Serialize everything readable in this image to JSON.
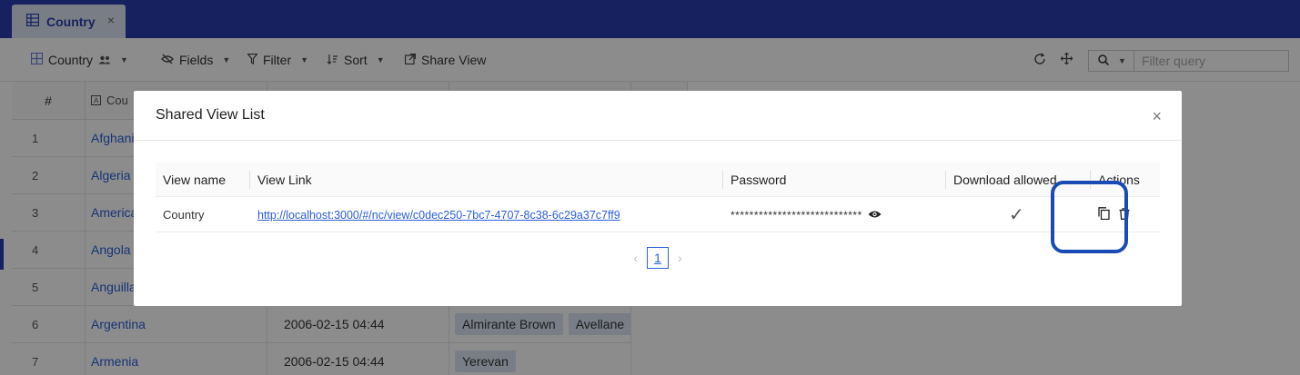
{
  "tab": {
    "label": "Country",
    "close": "×"
  },
  "toolbar": {
    "view_name": "Country",
    "fields": "Fields",
    "filter": "Filter",
    "sort": "Sort",
    "share_view": "Share View",
    "filter_placeholder": "Filter query"
  },
  "grid": {
    "headers": {
      "num": "#",
      "country": "Cou"
    },
    "rows": [
      {
        "num": "1",
        "country": "Afghani"
      },
      {
        "num": "2",
        "country": "Algeria"
      },
      {
        "num": "3",
        "country": "America"
      },
      {
        "num": "4",
        "country": "Angola"
      },
      {
        "num": "5",
        "country": "Anguilla"
      },
      {
        "num": "6",
        "country": "Argentina",
        "date": "2006-02-15 04:44",
        "cities": [
          "Almirante Brown",
          "Avellane"
        ]
      },
      {
        "num": "7",
        "country": "Armenia",
        "date": "2006-02-15 04:44",
        "cities": [
          "Yerevan"
        ]
      }
    ]
  },
  "modal": {
    "title": "Shared View List",
    "close": "×",
    "columns": [
      "View name",
      "View Link",
      "Password",
      "Download allowed",
      "Actions"
    ],
    "row": {
      "view_name": "Country",
      "link": "http://localhost:3000/#/nc/view/c0dec250-7bc7-4707-8c38-6c29a37c7ff9",
      "password": "****************************",
      "download_allowed": "✓"
    },
    "pagination": {
      "current": "1",
      "prev": "‹",
      "next": "›"
    }
  },
  "colors": {
    "brand": "#2b3db0",
    "link": "#2b5fd9",
    "highlight": "#1a4bb5"
  }
}
